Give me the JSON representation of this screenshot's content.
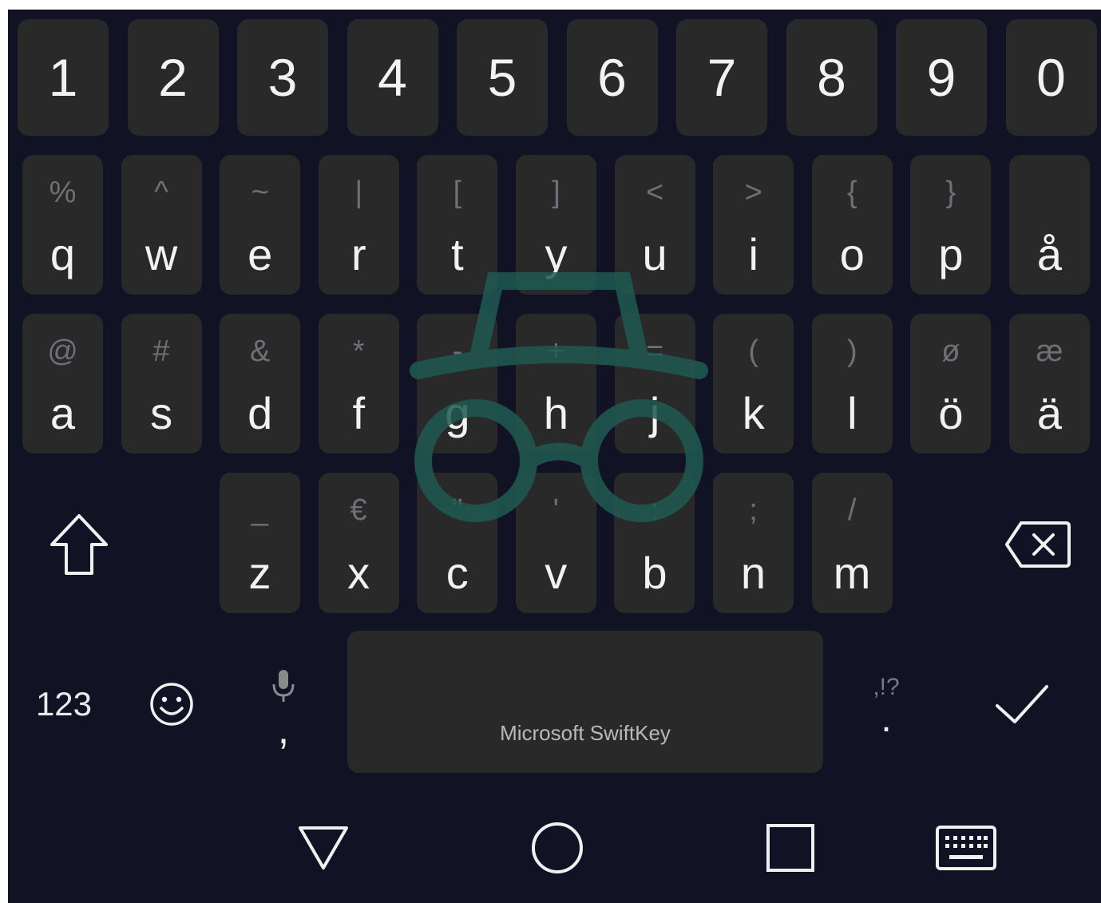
{
  "keyboard": {
    "number_row": [
      "1",
      "2",
      "3",
      "4",
      "5",
      "6",
      "7",
      "8",
      "9",
      "0"
    ],
    "row1": [
      {
        "main": "q",
        "hint": "%"
      },
      {
        "main": "w",
        "hint": "^"
      },
      {
        "main": "e",
        "hint": "~"
      },
      {
        "main": "r",
        "hint": "|"
      },
      {
        "main": "t",
        "hint": "["
      },
      {
        "main": "y",
        "hint": "]"
      },
      {
        "main": "u",
        "hint": "<"
      },
      {
        "main": "i",
        "hint": ">"
      },
      {
        "main": "o",
        "hint": "{"
      },
      {
        "main": "p",
        "hint": "}"
      },
      {
        "main": "å",
        "hint": ""
      }
    ],
    "row2": [
      {
        "main": "a",
        "hint": "@"
      },
      {
        "main": "s",
        "hint": "#"
      },
      {
        "main": "d",
        "hint": "&"
      },
      {
        "main": "f",
        "hint": "*"
      },
      {
        "main": "g",
        "hint": "-"
      },
      {
        "main": "h",
        "hint": "+"
      },
      {
        "main": "j",
        "hint": "="
      },
      {
        "main": "k",
        "hint": "("
      },
      {
        "main": "l",
        "hint": ")"
      },
      {
        "main": "ö",
        "hint": "ø"
      },
      {
        "main": "ä",
        "hint": "æ"
      }
    ],
    "row3": [
      {
        "main": "z",
        "hint": "_"
      },
      {
        "main": "x",
        "hint": "€"
      },
      {
        "main": "c",
        "hint": "\""
      },
      {
        "main": "v",
        "hint": "'"
      },
      {
        "main": "b",
        "hint": ":"
      },
      {
        "main": "n",
        "hint": ";"
      },
      {
        "main": "m",
        "hint": "/"
      }
    ],
    "bottom": {
      "numbers_label": "123",
      "comma_label": ",",
      "space_label": "Microsoft SwiftKey",
      "period_label": ".",
      "period_hint": ",!?"
    },
    "icons": {
      "shift": "shift-icon",
      "backspace": "backspace-icon",
      "emoji": "emoji-icon",
      "mic": "mic-icon",
      "enter": "checkmark-icon",
      "incognito": "incognito-icon"
    }
  },
  "navbar": {
    "icons": [
      "back-icon",
      "home-icon",
      "recents-icon",
      "keyboard-icon"
    ]
  },
  "colors": {
    "background": "#121225",
    "key": "#292929",
    "text": "#f2f2f2",
    "hint": "#6f6f78",
    "watermark": "#1f5a52"
  }
}
